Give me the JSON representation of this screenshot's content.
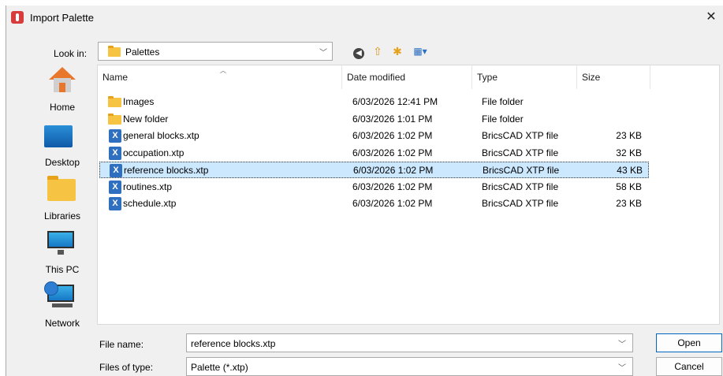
{
  "window": {
    "title": "Import Palette",
    "close_glyph": "✕"
  },
  "lookin": {
    "label": "Look in:",
    "value": "Palettes"
  },
  "toolbar": {
    "back_icon": "back-arrow-icon",
    "up_icon": "up-folder-icon",
    "new_folder_icon": "new-folder-icon",
    "view_icon": "view-menu-icon"
  },
  "places": [
    {
      "label": "Home",
      "icon": "home-icon"
    },
    {
      "label": "Desktop",
      "icon": "desktop-icon"
    },
    {
      "label": "Libraries",
      "icon": "libraries-icon"
    },
    {
      "label": "This PC",
      "icon": "this-pc-icon"
    },
    {
      "label": "Network",
      "icon": "network-icon"
    }
  ],
  "columns": {
    "name": "Name",
    "date": "Date modified",
    "type": "Type",
    "size": "Size"
  },
  "files": [
    {
      "name": "Images",
      "date": "6/03/2026 12:41 PM",
      "type": "File folder",
      "size": "",
      "kind": "folder"
    },
    {
      "name": "New folder",
      "date": "6/03/2026 1:01 PM",
      "type": "File folder",
      "size": "",
      "kind": "folder"
    },
    {
      "name": "general blocks.xtp",
      "date": "6/03/2026 1:02 PM",
      "type": "BricsCAD XTP file",
      "size": "23 KB",
      "kind": "xtp"
    },
    {
      "name": "occupation.xtp",
      "date": "6/03/2026 1:02 PM",
      "type": "BricsCAD XTP file",
      "size": "32 KB",
      "kind": "xtp"
    },
    {
      "name": "reference blocks.xtp",
      "date": "6/03/2026 1:02 PM",
      "type": "BricsCAD XTP file",
      "size": "43 KB",
      "kind": "xtp",
      "selected": true
    },
    {
      "name": "routines.xtp",
      "date": "6/03/2026 1:02 PM",
      "type": "BricsCAD XTP file",
      "size": "58 KB",
      "kind": "xtp"
    },
    {
      "name": "schedule.xtp",
      "date": "6/03/2026 1:02 PM",
      "type": "BricsCAD XTP file",
      "size": "23 KB",
      "kind": "xtp"
    }
  ],
  "filename": {
    "label": "File name:",
    "value": "reference blocks.xtp"
  },
  "filetype": {
    "label": "Files of type:",
    "value": "Palette (*.xtp)"
  },
  "buttons": {
    "open": "Open",
    "cancel": "Cancel"
  },
  "colors": {
    "selection": "#cce8ff",
    "folder": "#f6c343",
    "xtp_icon": "#2f6fbf"
  }
}
